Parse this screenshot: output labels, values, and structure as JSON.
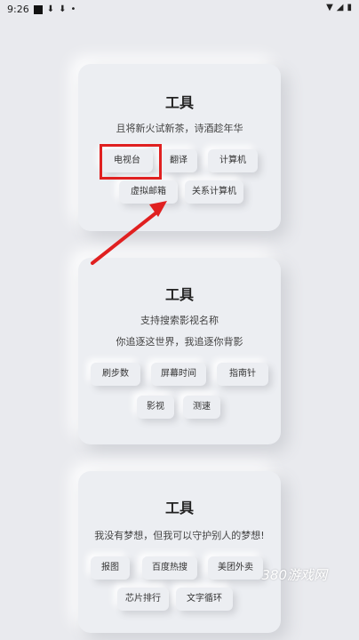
{
  "status": {
    "time": "9:26"
  },
  "cards": [
    {
      "title": "工具",
      "line1": "且将新火试新茶，诗酒趁年华",
      "buttons": [
        "电视台",
        "翻译",
        "计算机",
        "虚拟邮箱",
        "关系计算机"
      ]
    },
    {
      "title": "工具",
      "line1": "支持搜索影视名称",
      "line2": "你追逐这世界，我追逐你背影",
      "buttons": [
        "刷步数",
        "屏幕时间",
        "指南针",
        "影视",
        "测速"
      ]
    },
    {
      "title": "工具",
      "line1": "我没有梦想，但我可以守护别人的梦想!",
      "buttons": [
        "报图",
        "百度热搜",
        "美团外卖",
        "芯片排行",
        "文字循环"
      ]
    }
  ],
  "watermark": "380游戏网",
  "colors": {
    "highlight": "#e02020",
    "background": "#e9eaee"
  }
}
